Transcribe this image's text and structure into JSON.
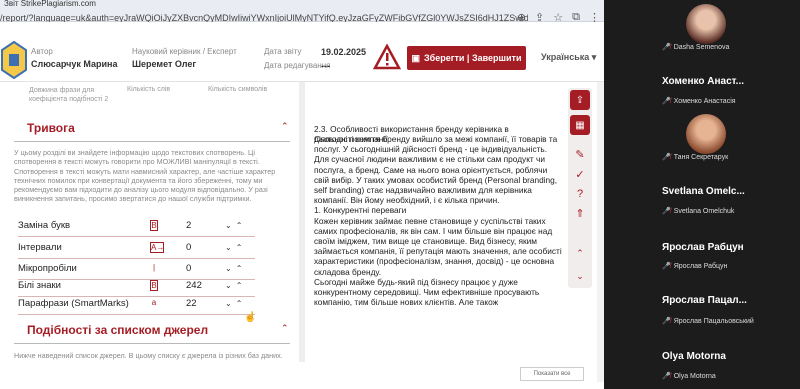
{
  "browser": {
    "window_title": "Звіт StrikePlagiarism.com",
    "url": "/report/?language=uk&auth=eyJraWQiOiJyZXBvcnQyMDIwIiwiYWxnIjoiUlMyNTYifQ.eyJzaGFyZWFibGVfZGl0YWJsZSI6dHJ1ZSwidmlld09ubHkiOm...",
    "toolbar_icons": [
      "zoom-icon",
      "share-icon",
      "star-icon",
      "extensions-icon",
      "more-icon"
    ]
  },
  "header": {
    "author_label": "Автор",
    "author_name": "Слюсарчук Марина",
    "supervisor_label": "Науковий керівник / Експерт",
    "supervisor_name": "Шеремет Олег",
    "date_submitted_label": "Дата звіту",
    "date_submitted_value": "19.02.2025",
    "date_edited_label": "Дата редагування",
    "date_edited_value": "---",
    "save_button_label": "Зберегти | Завершити",
    "language_label": "Українська"
  },
  "left_panel": {
    "stats": [
      "Довжина фрази для коефіцієнта подібності 2",
      "Кількість слів",
      "Кількість символів"
    ],
    "alert_title": "Тривога",
    "alert_text": "У цьому розділі ви знайдете інформацію щодо текстових спотворень. Ці спотворення в тексті можуть говорити про МОЖЛИВІ маніпуляції в тексті. Спотворення в тексті можуть мати навмисний характер, але частіше характер технічних помилок при конвертації документа та його збереженні, тому ми рекомендуємо вам підходити до аналізу цього модуля відповідально. У разі виникнення запитань, просимо звертатися до нашої служби підтримки.",
    "metrics": [
      {
        "label": "Заміна букв",
        "symbol": "B",
        "value": "2"
      },
      {
        "label": "Інтервали",
        "symbol": "A→",
        "value": "0"
      },
      {
        "label": "Мікропробіли",
        "symbol": "|",
        "value": "0"
      },
      {
        "label": "Білі знаки",
        "symbol": "B",
        "value": "242"
      },
      {
        "label": "Парафрази (SmartMarks)",
        "symbol": "a",
        "value": "22"
      }
    ],
    "sources_title": "Подібності за списком джерел",
    "sources_text": "Нижче наведений список джерел. В цьому списку є джерела із різних баз даних."
  },
  "document": {
    "heading": "2.3. Особливості використання бренду керівника в діяльності компанії",
    "paragraphs": [
      "Сьогодні поняття бренду вийшло за межі компанії, її товарів та послуг. У сьогоднішній дійсності бренд - це індивідуальність. Для сучасної людини важливим є не стільки сам продукт чи послуга, а бренд. Саме на нього вона орієнтується, роблячи свій вибір. У таких умовах особистий бренд (Personal branding, self branding) стає надзвичайно важливим для керівника компанії. Він йому необхідний, і є кілька причин.",
      "1. Конкурентні переваги",
      "Кожен керівник займає певне становище у суспільстві таких самих професіоналів, як він сам. І чим більше він працює над своїм іміджем, тим вище це становище. Вид бізнесу, яким займається компанія, її репутація мають значення, але особисті характеристики (професіоналізм, знання, досвід) - це основна складова бренду.",
      "Сьогодні майже будь-який під бізнесу працює у дуже конкурентному середовищі. Чим ефективніше просувають компанію, тим більше нових клієнтів. Але також"
    ]
  },
  "rail_icons": [
    "share-icon",
    "gallery-icon",
    "comment-icon",
    "check-icon",
    "help-icon",
    "up-icon",
    "chevron-up-icon",
    "chevron-down-icon"
  ],
  "bottom_button": "Показати все",
  "participants": [
    {
      "name": "",
      "sub": "Dasha Semenova"
    },
    {
      "name": "Хоменко Анаст...",
      "sub": "Хоменко Анастасія"
    },
    {
      "name": "",
      "sub": "Таня Секретарук"
    },
    {
      "name": "Svetlana Omelc...",
      "sub": "Svetlana Omelchuk"
    },
    {
      "name": "Ярослав Рабцун",
      "sub": "Ярослав Рабцун"
    },
    {
      "name": "Ярослав Пацал...",
      "sub": "Ярослав Пацальовський"
    },
    {
      "name": "Olya Motorna",
      "sub": "Olya Motorna"
    }
  ]
}
